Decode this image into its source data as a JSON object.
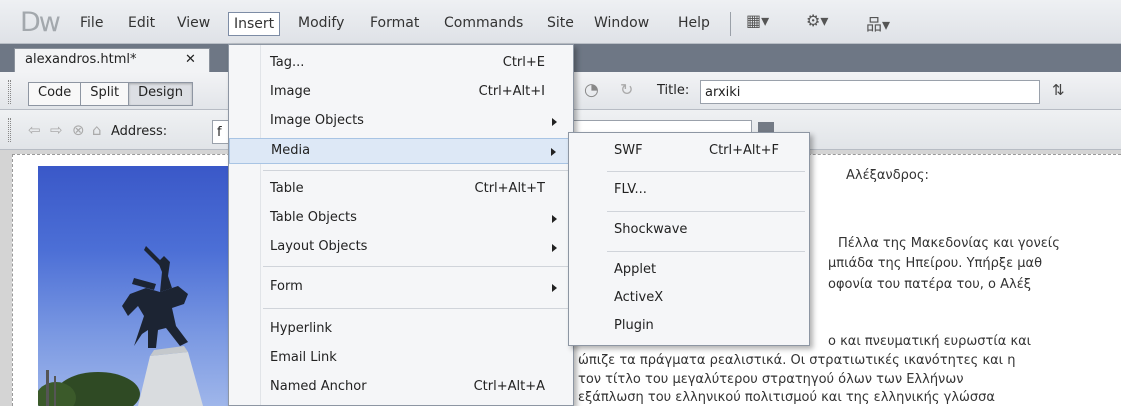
{
  "app": {
    "logo_text": "Dw"
  },
  "menubar": {
    "items": [
      "File",
      "Edit",
      "View",
      "Insert",
      "Modify",
      "Format",
      "Commands",
      "Site",
      "Window",
      "Help"
    ],
    "active": "Insert"
  },
  "toolbar_icons": {
    "layout": "▦▾",
    "extend": "⚙▾",
    "site": "品▾"
  },
  "document_tab": {
    "label": "alexandros.html*",
    "close": "✕"
  },
  "doc_toolbar": {
    "views": [
      "Code",
      "Split",
      "Design"
    ],
    "active_view": "Design",
    "title_label": "Title:",
    "title_value": "arxiki"
  },
  "browser_toolbar": {
    "address_label": "Address:",
    "address_value": "f"
  },
  "insert_menu": {
    "items": [
      {
        "label": "Tag...",
        "shortcut": "Ctrl+E"
      },
      {
        "label": "Image",
        "shortcut": "Ctrl+Alt+I"
      },
      {
        "label": "Image Objects",
        "submenu": true
      },
      {
        "label": "Media",
        "submenu": true,
        "highlighted": true
      },
      {
        "label": "Table",
        "shortcut": "Ctrl+Alt+T"
      },
      {
        "label": "Table Objects",
        "submenu": true
      },
      {
        "label": "Layout Objects",
        "submenu": true
      },
      {
        "label": "Form",
        "submenu": true
      },
      {
        "label": "Hyperlink"
      },
      {
        "label": "Email Link"
      },
      {
        "label": "Named Anchor",
        "shortcut": "Ctrl+Alt+A"
      }
    ]
  },
  "media_submenu": {
    "items": [
      {
        "label": "SWF",
        "shortcut": "Ctrl+Alt+F"
      },
      {
        "label": "FLV..."
      },
      {
        "label": "Shockwave"
      },
      {
        "label": "Applet"
      },
      {
        "label": "ActiveX"
      },
      {
        "label": "Plugin"
      }
    ]
  },
  "page_content": {
    "lines": [
      "Αλέξανδρος:",
      "Πέλλα της Μακεδονίας και γονείς",
      "μπιάδα της Ηπείρου. Υπήρξε μαθ",
      "οφονία του πατέρα του, ο Αλέξ",
      "ο και πνευματική ευρωστία και",
      "ώπιζε τα πράγματα ρεαλιστικά. Οι στρατιωτικές ικανότητες και η",
      "τον τίτλο του μεγαλύτερου στρατηγού όλων των Ελλήνων",
      "εξάπλωση του ελληνικού πολιτισμού και της ελληνικής γλώσσα"
    ]
  },
  "colors": {
    "menu_highlight": "#dde8f6",
    "tab_strip": "#6e7785"
  }
}
